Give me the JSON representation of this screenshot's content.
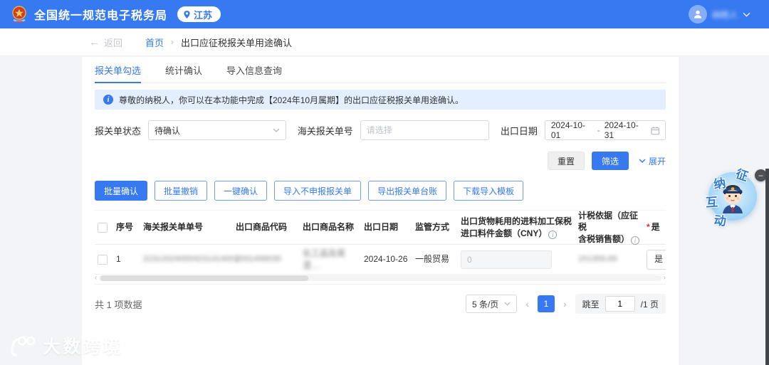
{
  "header": {
    "app_title": "全国统一规范电子税务局",
    "location": "江苏",
    "username": "纳税人"
  },
  "breadcrumb": {
    "back": "返回",
    "home": "首页",
    "current": "出口应征税报关单用途确认"
  },
  "tabs": [
    {
      "label": "报关单勾选",
      "active": true
    },
    {
      "label": "统计确认",
      "active": false
    },
    {
      "label": "导入信息查询",
      "active": false
    }
  ],
  "banner": {
    "text": "尊敬的纳税人，你可以在本功能中完成【2024年10月属期】的出口应征税报关单用途确认。"
  },
  "filters": {
    "status_label": "报关单状态",
    "status_value": "待确认",
    "customs_no_label": "海关报关单号",
    "customs_no_placeholder": "请选择",
    "export_date_label": "出口日期",
    "date_start": "2024-10-01",
    "date_separator": "-",
    "date_end": "2024-10-31",
    "reset_label": "重置",
    "filter_label": "筛选",
    "expand_label": "展开"
  },
  "actions": [
    {
      "label": "批量确认"
    },
    {
      "label": "批量撤销"
    },
    {
      "label": "一键确认"
    },
    {
      "label": "导入不申报报关单"
    },
    {
      "label": "导出报关单台账"
    },
    {
      "label": "下载导入模板"
    }
  ],
  "table": {
    "columns": {
      "seq": "序号",
      "customs_no": "海关报关单单号",
      "product_code": "出口商品代码",
      "product_name": "出口商品名称",
      "export_date": "出口日期",
      "supervision": "监管方式",
      "bonded_line1": "出口货物耗用的进料加工保税",
      "bonded_line2": "进口料件金额（CNY）",
      "basis_line1": "计税依据（应征税",
      "basis_line2": "含税销售额）",
      "confirm": "是"
    },
    "rows": [
      {
        "seq": "1",
        "customs_no": "223120240004231414001",
        "product_code": "2931499030",
        "product_name": "化工品及其混…",
        "export_date": "2024-10-26",
        "supervision": "一般贸易",
        "bonded_amount": "0",
        "tax_basis": "151359.69",
        "confirm": "是"
      }
    ]
  },
  "pagination": {
    "total_text": "共 1 项数据",
    "page_size": "5 条/页",
    "current_page": "1",
    "jump_label": "跳至",
    "jump_value": "1",
    "total_pages": "/1 页"
  },
  "float_widget": {
    "char1": "征",
    "char2": "纳",
    "char3": "互",
    "char4": "动",
    "minimize": "−"
  },
  "icons": {
    "back_arrow": "←",
    "crumb_sep": "›",
    "prev": "‹",
    "next": "›",
    "scroll_left": "‹",
    "scroll_right": "›"
  },
  "watermark": {
    "text": "大数跨境"
  },
  "colors": {
    "brand_blue": "#3679f0",
    "banner_bg": "#e3eeff",
    "page_bg": "#f2f4f7",
    "active_page_bg": "#3679f0",
    "required_red": "#f5222d"
  }
}
